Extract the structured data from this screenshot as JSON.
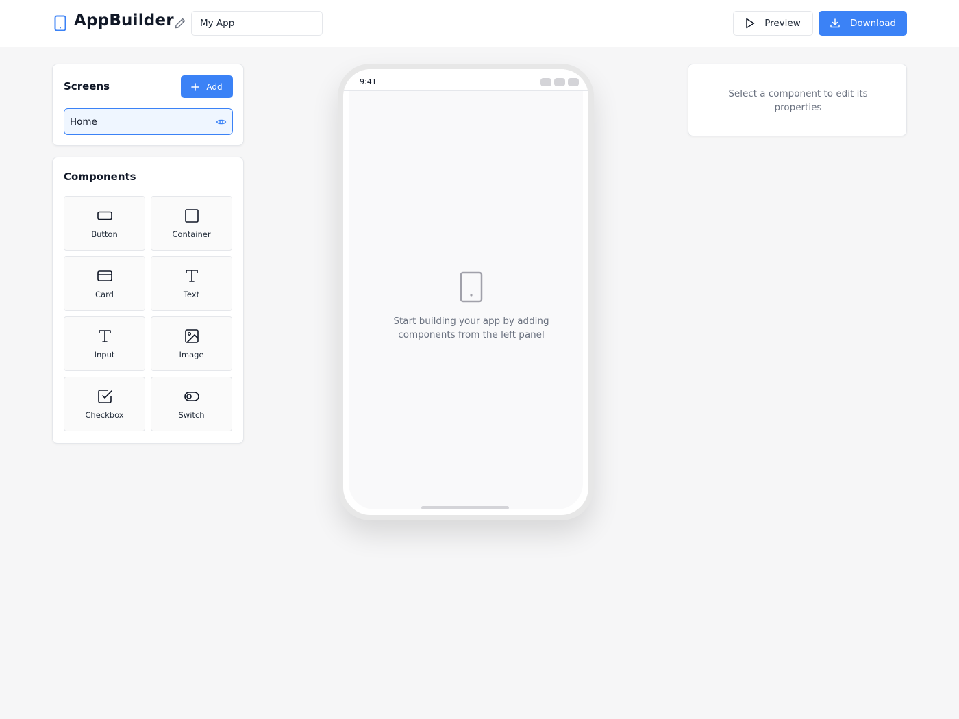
{
  "header": {
    "app_title": "AppBuilder",
    "app_name_value": "My App",
    "preview_label": "Preview",
    "download_label": "Download"
  },
  "colors": {
    "accent": "#3b82f6",
    "accent_light": "#eff6ff",
    "border": "#e5e7eb",
    "muted_text": "#6b7280",
    "background": "#f6f6f7"
  },
  "screens": {
    "title": "Screens",
    "add_label": "Add",
    "items": [
      {
        "label": "Home",
        "selected": true,
        "icon": "eye-icon"
      }
    ]
  },
  "components": {
    "title": "Components",
    "items": [
      {
        "label": "Button",
        "icon": "button-icon"
      },
      {
        "label": "Container",
        "icon": "square-icon"
      },
      {
        "label": "Card",
        "icon": "card-icon"
      },
      {
        "label": "Text",
        "icon": "text-icon"
      },
      {
        "label": "Input",
        "icon": "text-icon"
      },
      {
        "label": "Image",
        "icon": "image-icon"
      },
      {
        "label": "Checkbox",
        "icon": "checkbox-icon"
      },
      {
        "label": "Switch",
        "icon": "switch-icon"
      }
    ]
  },
  "phone": {
    "status_time": "9:41",
    "empty_message": "Start building your app by adding components from the left panel"
  },
  "properties": {
    "empty_message": "Select a component to edit its properties"
  }
}
